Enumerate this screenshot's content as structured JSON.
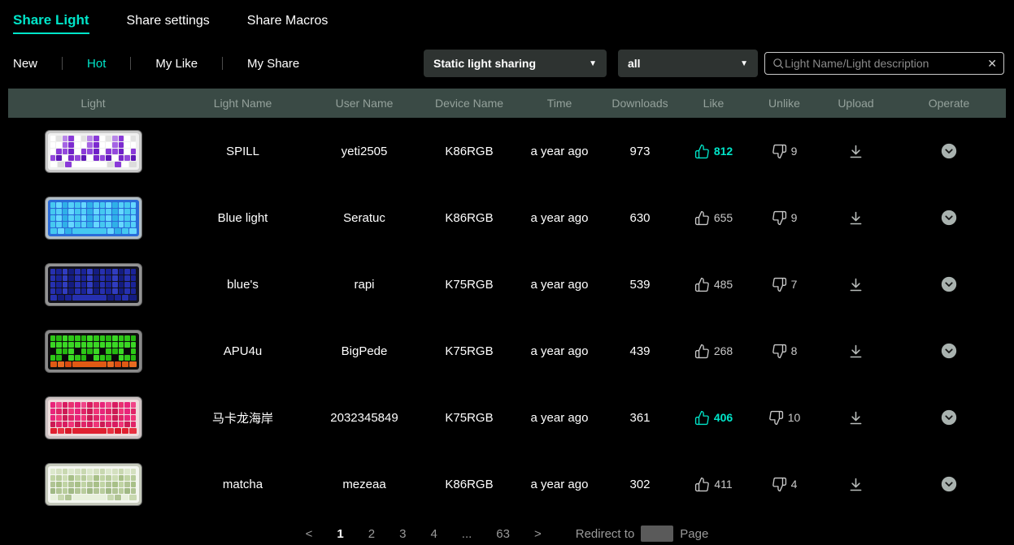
{
  "colors": {
    "accent": "#00e5c9",
    "header_bg": "#3a4a45"
  },
  "nav": {
    "tabs": [
      {
        "label": "Share Light"
      },
      {
        "label": "Share settings"
      },
      {
        "label": "Share Macros"
      }
    ],
    "active": "Share Light"
  },
  "filters": {
    "items": [
      {
        "label": "New"
      },
      {
        "label": "Hot"
      },
      {
        "label": "My Like"
      },
      {
        "label": "My Share"
      }
    ],
    "active": "Hot"
  },
  "dropdowns": {
    "light_type": {
      "value": "Static light sharing"
    },
    "device": {
      "value": "all"
    }
  },
  "search": {
    "placeholder": "Light Name/Light description"
  },
  "table": {
    "headers": [
      "Light",
      "Light Name",
      "User Name",
      "Device Name",
      "Time",
      "Downloads",
      "Like",
      "Unlike",
      "Upload",
      "Operate"
    ],
    "rows": [
      {
        "light_name": "SPILL",
        "user": "yeti2505",
        "device": "K86RGB",
        "time": "a year ago",
        "downloads": "973",
        "like": "812",
        "liked": true,
        "unlike": "9",
        "thumb": {
          "frame": "#c9c9c9",
          "board": "#f0f0f0",
          "rows": [
            [
              "#ffffff",
              "#e2e2e2",
              "#b887e8",
              "#8a3ad8"
            ],
            [
              "#ffffff",
              "#a564e4",
              "#7c2ad0",
              "#ffffff"
            ],
            [
              "#9348dc",
              "#6f20c8",
              "#ffffff",
              "#8a3ad8"
            ],
            [
              "#7a28cc",
              "#9348dc",
              "#5f18b8",
              "#ffffff"
            ],
            [
              "#ffffff",
              "#8a3ad8",
              "#dcdcdc"
            ]
          ]
        }
      },
      {
        "light_name": "Blue light",
        "user": "Seratuc",
        "device": "K86RGB",
        "time": "a year ago",
        "downloads": "630",
        "like": "655",
        "liked": false,
        "unlike": "9",
        "thumb": {
          "frame": "#b2bec6",
          "board": "#2a6cd8",
          "rows": [
            [
              "#45c8f0",
              "#66d8ff",
              "#2fb0e8",
              "#55d0f8"
            ],
            [
              "#55d0f8",
              "#2fb0e8",
              "#66d8ff",
              "#45c8f0"
            ],
            [
              "#2fb0e8",
              "#55d0f8",
              "#45c8f0",
              "#66d8ff"
            ],
            [
              "#66d8ff",
              "#45c8f0",
              "#55d0f8",
              "#2fb0e8"
            ],
            [
              "#45c8f0",
              "#2fb0e8",
              "#66d8ff"
            ]
          ]
        }
      },
      {
        "light_name": "blue's",
        "user": "rapi",
        "device": "K75RGB",
        "time": "a year ago",
        "downloads": "539",
        "like": "485",
        "liked": false,
        "unlike": "7",
        "thumb": {
          "frame": "#949494",
          "board": "#12121c",
          "rows": [
            [
              "#2630b0",
              "#1a2398",
              "#303cc0",
              "#141c80"
            ],
            [
              "#1a2398",
              "#303cc0",
              "#141c80",
              "#2630b0"
            ],
            [
              "#303cc0",
              "#141c80",
              "#2630b0",
              "#1a2398"
            ],
            [
              "#141c80",
              "#2630b0",
              "#1a2398",
              "#303cc0"
            ],
            [
              "#2630b0",
              "#1a2398",
              "#141c80"
            ]
          ]
        }
      },
      {
        "light_name": "APU4u",
        "user": "BigPede",
        "device": "K75RGB",
        "time": "a year ago",
        "downloads": "439",
        "like": "268",
        "liked": false,
        "unlike": "8",
        "thumb": {
          "frame": "#8a8a8a",
          "board": "#0e0e0e",
          "rows": [
            [
              "#2ec818",
              "#24b810",
              "#3ad824",
              "#2ec818"
            ],
            [
              "#2ec818",
              "#0a0a0a",
              "#24b810",
              "#3ad824",
              "#0a0a0a"
            ],
            [
              "#24b810",
              "#3ad824",
              "#0a0a0a",
              "#2ec818"
            ],
            [
              "#3ad824",
              "#2ec818",
              "#24b810",
              "#0a0a0a"
            ],
            [
              "#e05a14",
              "#d84a10",
              "#e86a20"
            ]
          ]
        }
      },
      {
        "light_name": "马卡龙海岸",
        "user": "2032345849",
        "device": "K75RGB",
        "time": "a year ago",
        "downloads": "361",
        "like": "406",
        "liked": true,
        "unlike": "10",
        "thumb": {
          "frame": "#ccc2c2",
          "board": "#eedcdc",
          "rows": [
            [
              "#e8247a",
              "#f04488",
              "#d81b60",
              "#e83070"
            ],
            [
              "#e02468",
              "#cc1a55",
              "#f03478",
              "#e8247a"
            ],
            [
              "#cc1a55",
              "#e02468",
              "#e8247a",
              "#f03478"
            ],
            [
              "#f03478",
              "#cc1a55",
              "#e02468",
              "#d81b60"
            ],
            [
              "#e02030",
              "#d81828",
              "#e83040"
            ]
          ]
        }
      },
      {
        "light_name": "matcha",
        "user": "mezeaa",
        "device": "K86RGB",
        "time": "a year ago",
        "downloads": "302",
        "like": "411",
        "liked": false,
        "unlike": "4",
        "thumb": {
          "frame": "#c6cabc",
          "board": "#f4f6f0",
          "rows": [
            [
              "#dce8cc",
              "#c8d8b0",
              "#d4e0c0"
            ],
            [
              "#b8cc9c",
              "#ccdcb4",
              "#a8c088",
              "#c0d4a4"
            ],
            [
              "#b0c494",
              "#c0d4a4",
              "#a8c088"
            ],
            [
              "#a0b884",
              "#b8cc9c",
              "#b0c494"
            ],
            [
              "#e8f0dc",
              "#b0c494",
              "#c8d8b0"
            ]
          ]
        }
      }
    ]
  },
  "pagination": {
    "prev": "<",
    "next": ">",
    "pages": [
      "1",
      "2",
      "3",
      "4",
      "...",
      "63"
    ],
    "active": "1",
    "redirect_label": "Redirect to",
    "page_suffix": "Page"
  }
}
